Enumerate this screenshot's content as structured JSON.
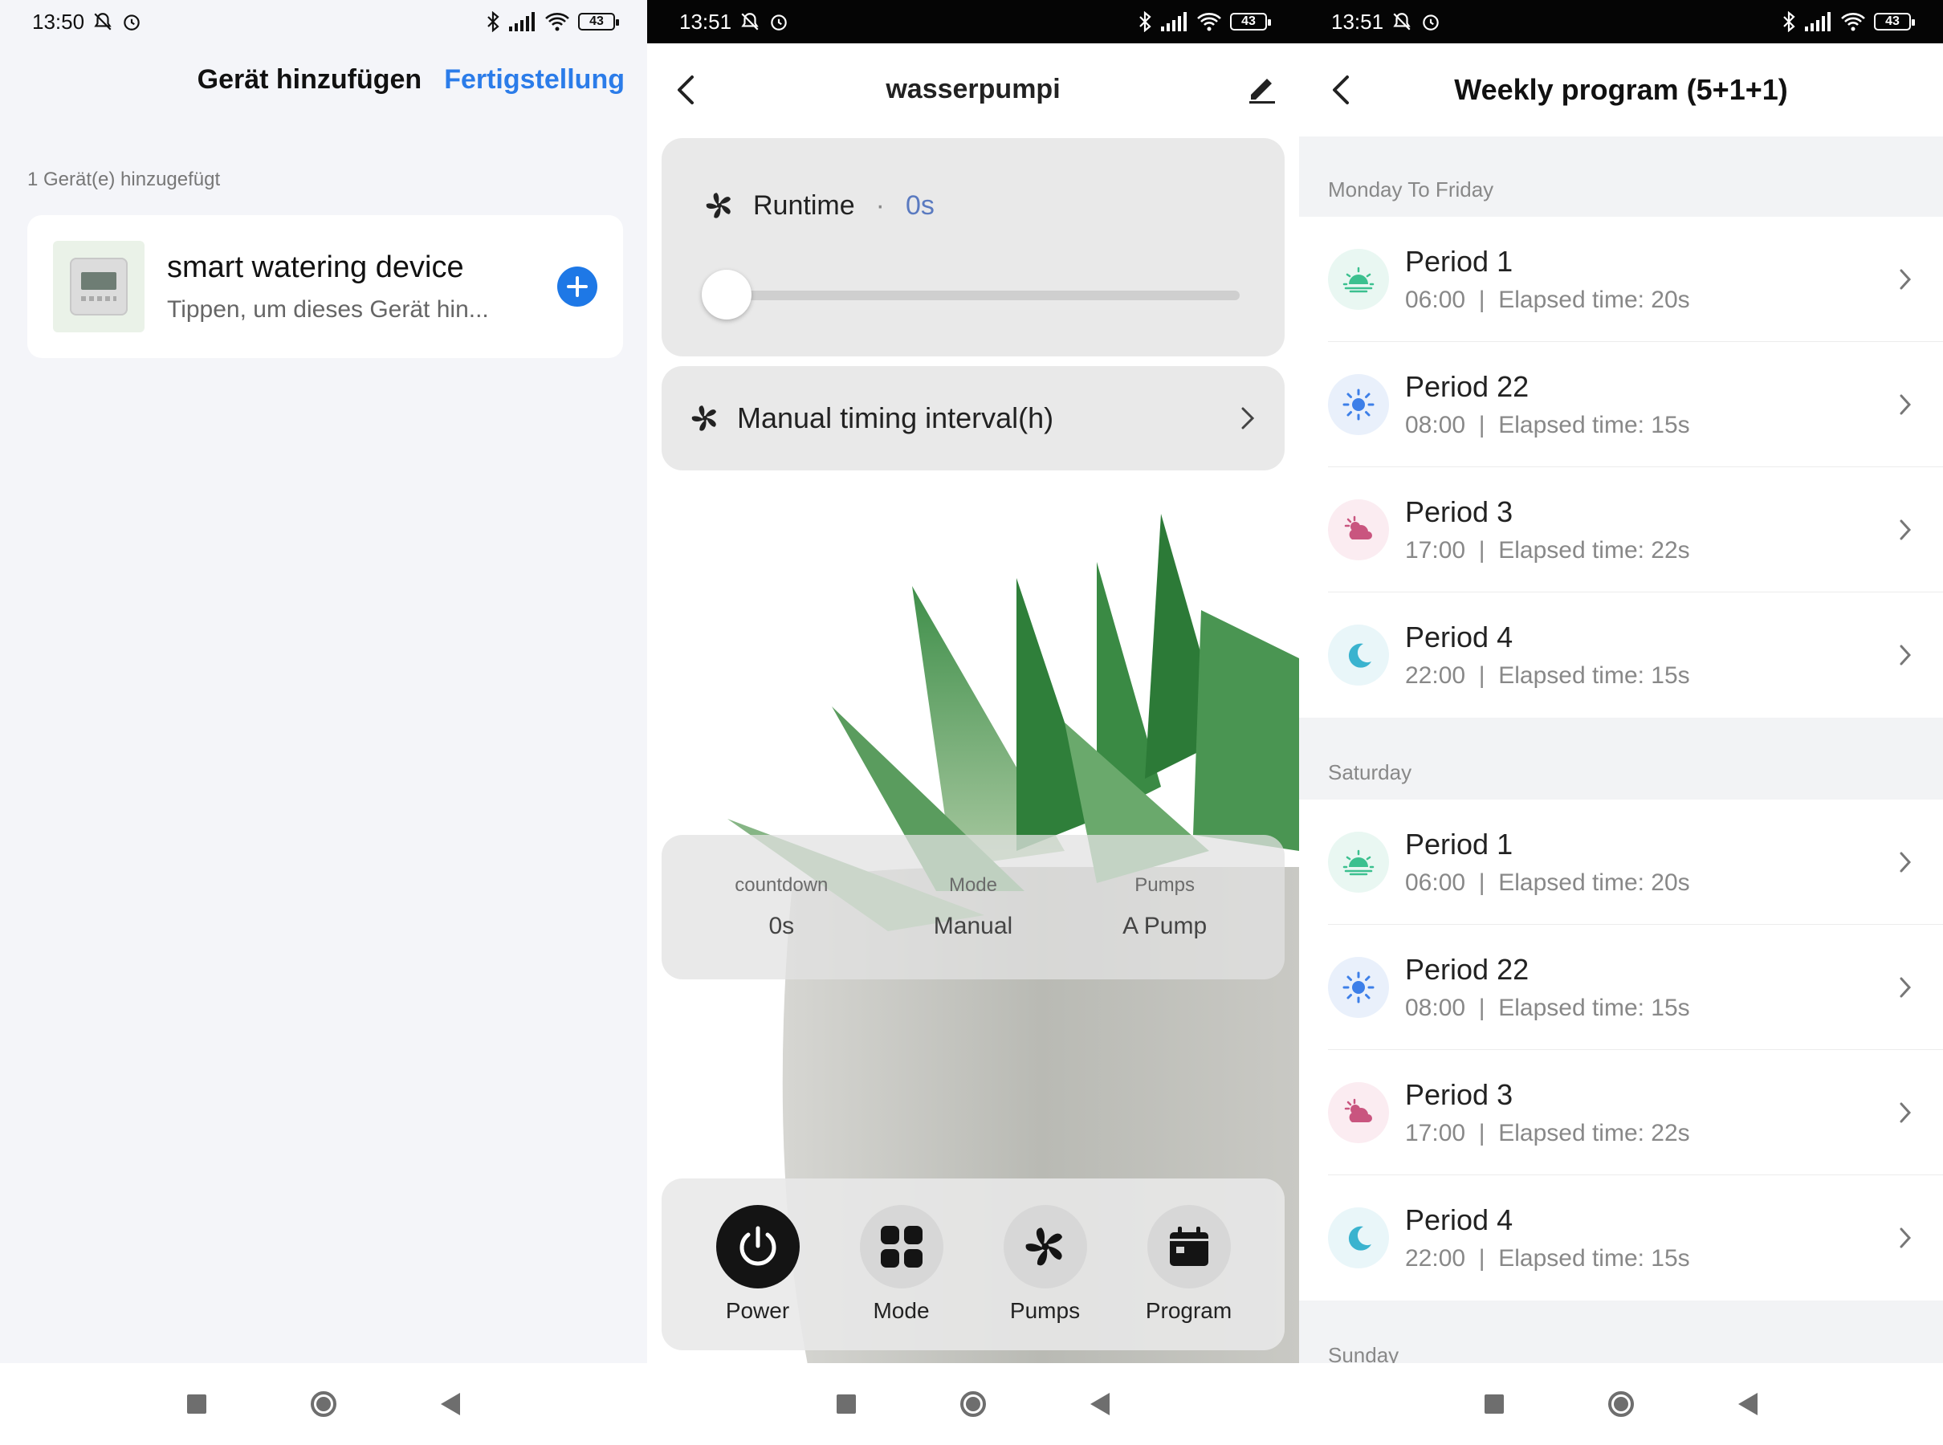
{
  "panel1": {
    "status": {
      "time": "13:50",
      "battery": "43"
    },
    "header": {
      "title": "Gerät hinzufügen",
      "done": "Fertigstellung"
    },
    "count_label": "1 Gerät(e) hinzugefügt",
    "device": {
      "name": "smart watering device",
      "hint": "Tippen, um dieses Gerät hin..."
    }
  },
  "panel2": {
    "status": {
      "time": "13:51",
      "battery": "43"
    },
    "title": "wasserpumpi",
    "runtime": {
      "label": "Runtime",
      "value": "0s",
      "slider_fraction": 0
    },
    "interval": {
      "label": "Manual timing interval(h)"
    },
    "status_items": [
      {
        "label": "countdown",
        "value": "0s"
      },
      {
        "label": "Mode",
        "value": "Manual"
      },
      {
        "label": "Pumps",
        "value": "A Pump"
      }
    ],
    "controls": [
      {
        "label": "Power",
        "icon": "power-icon"
      },
      {
        "label": "Mode",
        "icon": "grid-icon"
      },
      {
        "label": "Pumps",
        "icon": "fan-icon"
      },
      {
        "label": "Program",
        "icon": "calendar-icon"
      }
    ]
  },
  "panel3": {
    "status": {
      "time": "13:51",
      "battery": "43"
    },
    "title": "Weekly program (5+1+1)",
    "sections": [
      {
        "label": "Monday To Friday",
        "periods": [
          {
            "name": "Period 1",
            "time": "06:00",
            "elapsed": "Elapsed time: 20s",
            "icon": "sunrise-icon"
          },
          {
            "name": "Period 22",
            "time": "08:00",
            "elapsed": "Elapsed time: 15s",
            "icon": "sun-icon"
          },
          {
            "name": "Period 3",
            "time": "17:00",
            "elapsed": "Elapsed time: 22s",
            "icon": "cloud-sun-icon"
          },
          {
            "name": "Period 4",
            "time": "22:00",
            "elapsed": "Elapsed time: 15s",
            "icon": "moon-icon"
          }
        ]
      },
      {
        "label": "Saturday",
        "periods": [
          {
            "name": "Period 1",
            "time": "06:00",
            "elapsed": "Elapsed time: 20s",
            "icon": "sunrise-icon"
          },
          {
            "name": "Period 22",
            "time": "08:00",
            "elapsed": "Elapsed time: 15s",
            "icon": "sun-icon"
          },
          {
            "name": "Period 3",
            "time": "17:00",
            "elapsed": "Elapsed time: 22s",
            "icon": "cloud-sun-icon"
          },
          {
            "name": "Period 4",
            "time": "22:00",
            "elapsed": "Elapsed time: 15s",
            "icon": "moon-icon"
          }
        ]
      },
      {
        "label": "Sunday",
        "periods": []
      }
    ]
  },
  "colors": {
    "accent_blue": "#2b7ce9",
    "add_button": "#1e78e6",
    "runtime_value": "#5a7ac0",
    "power_on": "#141414"
  }
}
